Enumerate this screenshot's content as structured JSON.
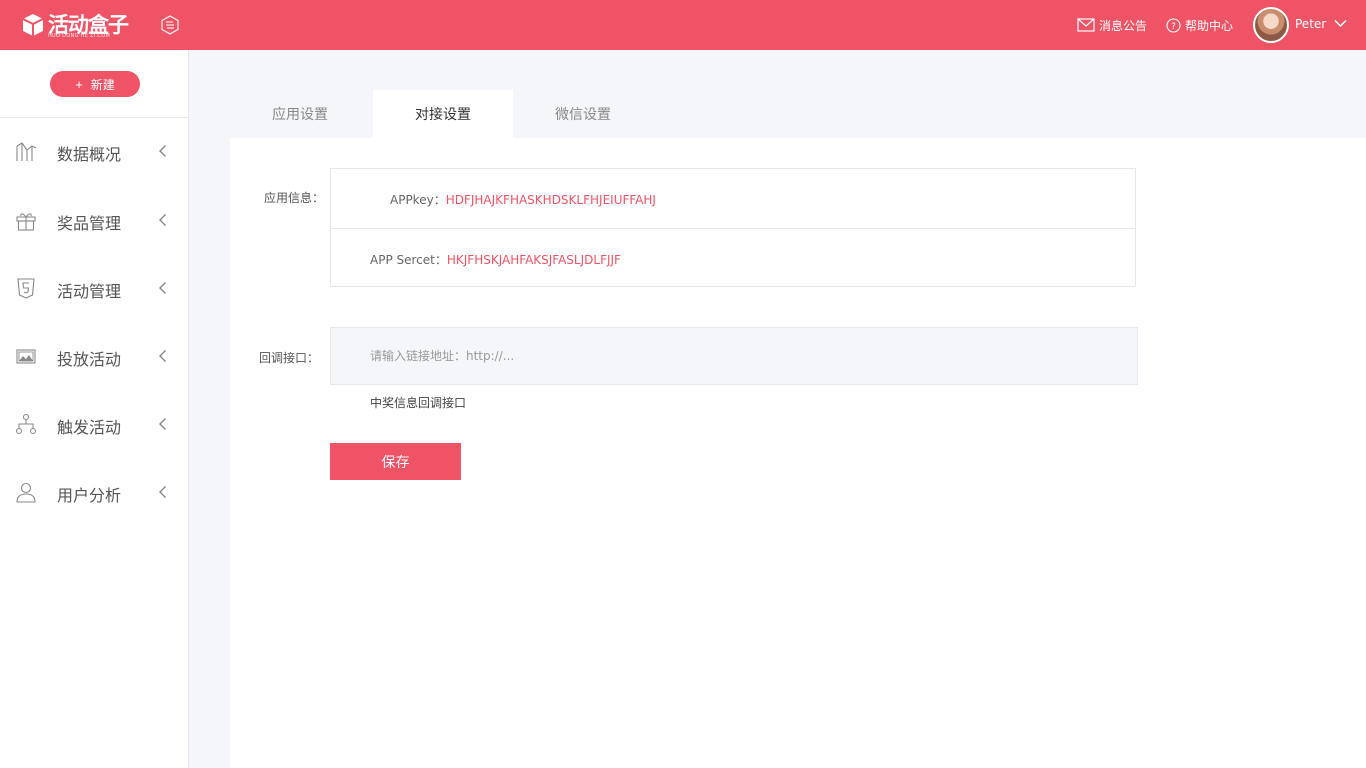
{
  "header": {
    "logo_text": "活动盒子",
    "logo_subtext": "HUO DONG HE ZI.COM",
    "links": [
      {
        "label": "消息公告",
        "icon": "mail-icon"
      },
      {
        "label": "帮助中心",
        "icon": "help-circle-icon"
      }
    ],
    "user": {
      "name": "Peter"
    },
    "colors": {
      "brand": "#ef5466"
    }
  },
  "sidebar": {
    "new_button": {
      "icon": "+",
      "label": "新建"
    },
    "items": [
      {
        "label": "数据概况",
        "icon": "chart-icon"
      },
      {
        "label": "奖品管理",
        "icon": "gift-icon"
      },
      {
        "label": "活动管理",
        "icon": "html5-icon"
      },
      {
        "label": "投放活动",
        "icon": "image-icon"
      },
      {
        "label": "触发活动",
        "icon": "flow-icon"
      },
      {
        "label": "用户分析",
        "icon": "user-icon"
      }
    ]
  },
  "main": {
    "tabs": [
      {
        "label": "应用设置",
        "active": false
      },
      {
        "label": "对接设置",
        "active": true
      },
      {
        "label": "微信设置",
        "active": false
      }
    ],
    "app_info": {
      "label": "应用信息：",
      "appkey_label": "APPkey：",
      "appkey_value": "HDFJHAJKFHASKHDSKLFHJEIUFFAHJ",
      "secret_label": "APP Sercet：",
      "secret_value": "HKJFHSKJAHFAKSJFASLJDLFJJF"
    },
    "callback": {
      "label": "回调接口：",
      "placeholder": "请输入链接地址：http://...",
      "hint": "中奖信息回调接口"
    },
    "save_label": "保存"
  }
}
